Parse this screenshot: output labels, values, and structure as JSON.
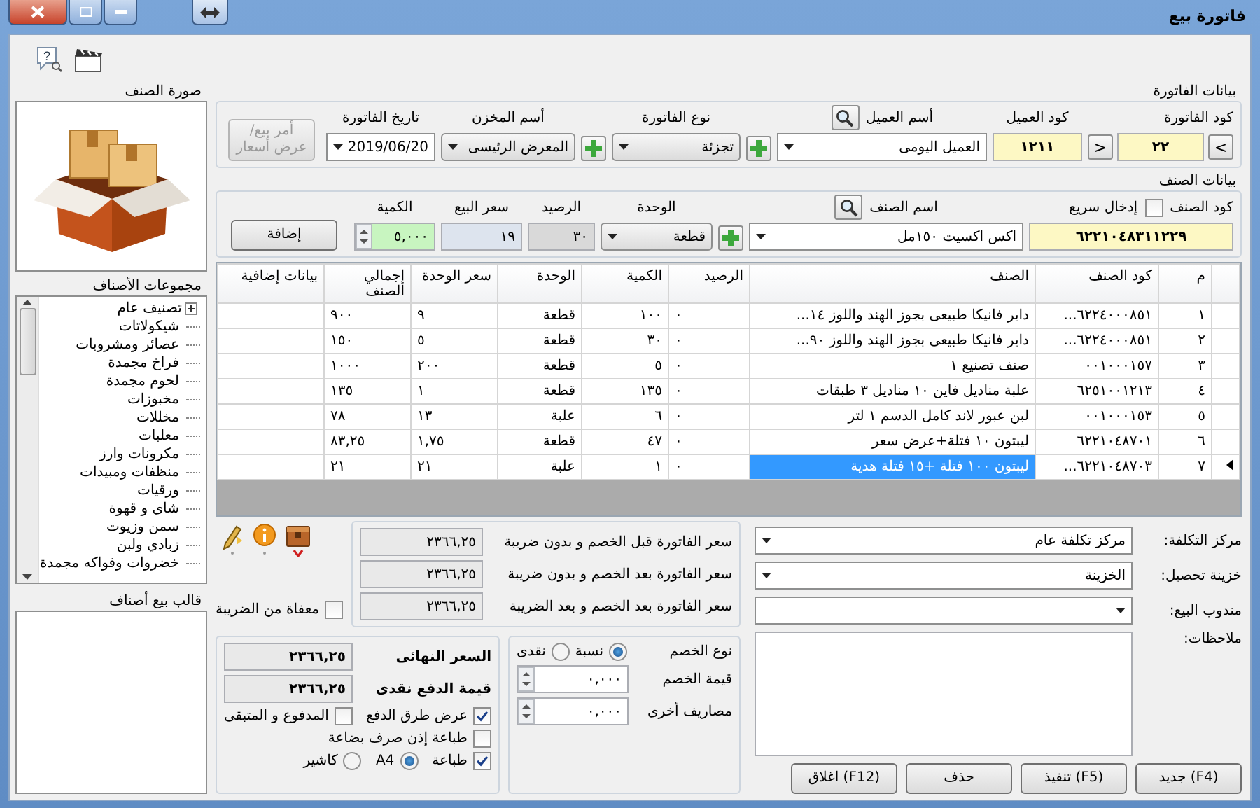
{
  "window": {
    "title": "فاتورة بيع"
  },
  "toolbar": {
    "help_glyph": "?"
  },
  "invoice": {
    "legend": "بيانات الفاتورة",
    "code_label": "كود الفاتورة",
    "nav_buttons": [
      ">",
      "<"
    ],
    "code": "٢٢",
    "customer_code_label": "كود العميل",
    "customer_code": "١٢١١",
    "customer_name_label": "أسم العميل",
    "customer_name": "العميل اليومى",
    "type_label": "نوع الفاتورة",
    "type": "تجزئة",
    "store_label": "أسم المخزن",
    "store": "المعرض الرئيسى",
    "date_label": "تاريخ الفاتورة",
    "date": "2019/06/20",
    "order_button": {
      "label": "أمر بيع/ عرض أسعار",
      "disabled": true
    }
  },
  "item": {
    "legend": "بيانات الصنف",
    "code_label": "كود الصنف",
    "quick_entry": {
      "label": "إدخال سريع",
      "checked": false
    },
    "code": "٦٢٢١٠٤٨٣١١٢٢٩",
    "name_label": "اسم الصنف",
    "name": "اكس اكسيت ١٥٠مل",
    "unit_label": "الوحدة",
    "unit": "قطعة",
    "balance_label": "الرصيد",
    "balance": "٣٠",
    "price_label": "سعر البيع",
    "price": "١٩",
    "qty_label": "الكمية",
    "qty": "٥,٠٠٠",
    "add_button": "إضافة"
  },
  "table": {
    "columns": [
      "م",
      "كود الصنف",
      "الصنف",
      "الرصيد",
      "الكمية",
      "الوحدة",
      "سعر الوحدة",
      "إجمالي الصنف",
      "بيانات إضافية"
    ],
    "rows": [
      {
        "cells": [
          "١",
          "٦٢٢٤٠٠٠٨٥١...",
          "داير فانيكا طبيعى بجوز الهند واللوز ١٤...",
          "٠",
          "١٠٠",
          "قطعة",
          "٩",
          "٩٠٠"
        ],
        "selected": false
      },
      {
        "cells": [
          "٢",
          "٦٢٢٤٠٠٠٨٥١...",
          "داير فانيكا طبيعى بجوز الهند واللوز ٩٠...",
          "٠",
          "٣٠",
          "قطعة",
          "٥",
          "١٥٠"
        ],
        "selected": false
      },
      {
        "cells": [
          "٣",
          "٠٠١٠٠٠١٥٧",
          "صنف تصنيع ١",
          "٠",
          "٥",
          "قطعة",
          "٢٠٠",
          "١٠٠٠"
        ],
        "selected": false
      },
      {
        "cells": [
          "٤",
          "٦٢٥١٠٠١٢١٣",
          "علبة مناديل فاين ١٠ مناديل ٣ طبقات",
          "٠",
          "١٣٥",
          "قطعة",
          "١",
          "١٣٥"
        ],
        "selected": false
      },
      {
        "cells": [
          "٥",
          "٠٠١٠٠٠١٥٣",
          "لبن عبور لاند كامل الدسم ١ لتر",
          "٠",
          "٦",
          "علبة",
          "١٣",
          "٧٨"
        ],
        "selected": false
      },
      {
        "cells": [
          "٦",
          "٦٢٢١٠٤٨٧٠١",
          "ليبتون ١٠ فتلة+عرض سعر",
          "٠",
          "٤٧",
          "قطعة",
          "١,٧٥",
          "٨٣,٢٥"
        ],
        "selected": false
      },
      {
        "cells": [
          "٧",
          "٦٢٢١٠٤٨٧٠٣...",
          "ليبتون ١٠٠ فتلة +١٥ فتلة هدية",
          "٠",
          "١",
          "علبة",
          "٢١",
          "٢١"
        ],
        "selected": true
      }
    ]
  },
  "footer": {
    "fields": [
      {
        "label": "مركز التكلفة:",
        "value": "مركز تكلفة عام"
      },
      {
        "label": "خزينة تحصيل:",
        "value": "الخزينة"
      },
      {
        "label": "مندوب البيع:"
      }
    ],
    "notes_label": "ملاحظات:",
    "buttons": [
      "جديد (F4)",
      "تنفيذ (F5)",
      "حذف",
      "اغلاق (F12)"
    ]
  },
  "totals": [
    {
      "label": "سعر الفاتورة قبل الخصم و بدون ضريبة",
      "value": "٢٣٦٦,٢٥"
    },
    {
      "label": "سعر الفاتورة بعد الخصم و بدون ضريبة",
      "value": "٢٣٦٦,٢٥"
    },
    {
      "label": "سعر الفاتورة بعد الخصم و بعد الضريبة",
      "value": "٢٣٦٦,٢٥"
    }
  ],
  "tax_exempt": {
    "label": "معفاة من الضريبة",
    "checked": false
  },
  "discount": {
    "type_label": "نوع الخصم",
    "types": [
      {
        "label": "نسبة",
        "selected": true
      },
      {
        "label": "نقدى",
        "selected": false
      }
    ],
    "value_label": "قيمة الخصم",
    "value": "٠,٠٠٠",
    "other_label": "مصاريف أخرى",
    "other": "٠,٠٠٠"
  },
  "final": {
    "final_label": "السعر النهائى",
    "final": "٢٣٦٦,٢٥",
    "cash_label": "قيمة الدفع نقدى",
    "cash": "٢٣٦٦,٢٥",
    "show_payment": {
      "label": "عرض طرق الدفع",
      "checked": true
    },
    "paid_remaining": {
      "label": "المدفوع و المتبقى",
      "checked": false
    },
    "print_issue": {
      "label": "طباعة إذن صرف بضاعة",
      "checked": false
    },
    "print": {
      "label": "طباعة",
      "checked": true
    },
    "formats": [
      {
        "label": "A4",
        "selected": true
      },
      {
        "label": "كاشير",
        "selected": false
      }
    ]
  },
  "left": {
    "image_label": "صورة الصنف",
    "groups_label": "مجموعات الأصناف",
    "groups": [
      {
        "label": "تصنيف عام",
        "kind": "collapsed"
      },
      {
        "label": "شيكولاتات",
        "kind": "leaf"
      },
      {
        "label": "عصائر ومشروبات",
        "kind": "leaf"
      },
      {
        "label": "فراخ مجمدة",
        "kind": "leaf"
      },
      {
        "label": "لحوم مجمدة",
        "kind": "leaf"
      },
      {
        "label": "مخبوزات",
        "kind": "leaf"
      },
      {
        "label": "مخللات",
        "kind": "leaf"
      },
      {
        "label": "معلبات",
        "kind": "leaf"
      },
      {
        "label": "مكرونات وارز",
        "kind": "leaf"
      },
      {
        "label": "منظفات ومبيدات",
        "kind": "leaf"
      },
      {
        "label": "ورقيات",
        "kind": "leaf"
      },
      {
        "label": "شاى و قهوة",
        "kind": "leaf"
      },
      {
        "label": "سمن وزيوت",
        "kind": "leaf"
      },
      {
        "label": "زبادي ولبن",
        "kind": "leaf"
      },
      {
        "label": "خضروات وفواكه مجمدة",
        "kind": "leaf"
      }
    ],
    "template_label": "قالب بيع أصناف"
  }
}
